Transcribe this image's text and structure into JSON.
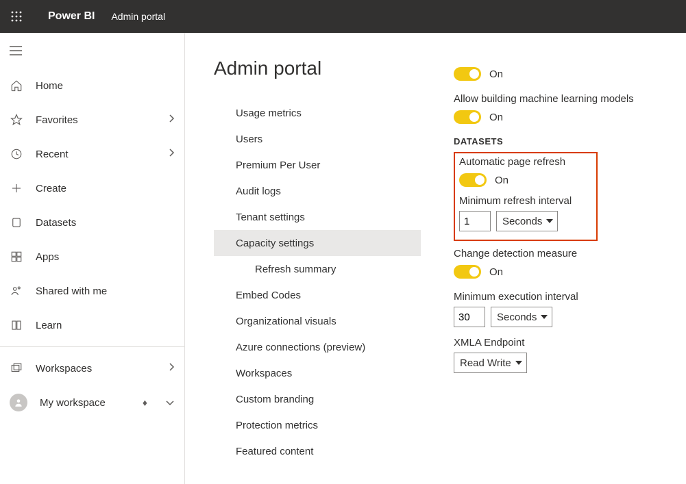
{
  "header": {
    "app_name": "Power BI",
    "page_name": "Admin portal"
  },
  "sidebar": {
    "items": [
      {
        "label": "Home",
        "icon": "home",
        "chevron": false
      },
      {
        "label": "Favorites",
        "icon": "star",
        "chevron": true
      },
      {
        "label": "Recent",
        "icon": "clock",
        "chevron": true
      },
      {
        "label": "Create",
        "icon": "plus",
        "chevron": false
      },
      {
        "label": "Datasets",
        "icon": "db",
        "chevron": false
      },
      {
        "label": "Apps",
        "icon": "apps",
        "chevron": false
      },
      {
        "label": "Shared with me",
        "icon": "shared",
        "chevron": false
      },
      {
        "label": "Learn",
        "icon": "book",
        "chevron": false
      }
    ],
    "workspaces_label": "Workspaces",
    "my_workspace_label": "My workspace"
  },
  "main": {
    "title": "Admin portal",
    "nav": [
      {
        "label": "Usage metrics"
      },
      {
        "label": "Users"
      },
      {
        "label": "Premium Per User"
      },
      {
        "label": "Audit logs"
      },
      {
        "label": "Tenant settings"
      },
      {
        "label": "Capacity settings",
        "selected": true
      },
      {
        "label": "Refresh summary",
        "sub": true
      },
      {
        "label": "Embed Codes"
      },
      {
        "label": "Organizational visuals"
      },
      {
        "label": "Azure connections (preview)"
      },
      {
        "label": "Workspaces"
      },
      {
        "label": "Custom branding"
      },
      {
        "label": "Protection metrics"
      },
      {
        "label": "Featured content"
      }
    ]
  },
  "settings": {
    "top_toggle1_label": "On",
    "ml_models_label": "Allow building machine learning models",
    "ml_toggle_label": "On",
    "section_heading": "DATASETS",
    "auto_refresh_label": "Automatic page refresh",
    "auto_refresh_toggle_label": "On",
    "min_refresh_label": "Minimum refresh interval",
    "min_refresh_value": "1",
    "min_refresh_unit": "Seconds",
    "change_detection_label": "Change detection measure",
    "change_detection_toggle_label": "On",
    "min_exec_label": "Minimum execution interval",
    "min_exec_value": "30",
    "min_exec_unit": "Seconds",
    "xmla_label": "XMLA Endpoint",
    "xmla_value": "Read Write"
  }
}
